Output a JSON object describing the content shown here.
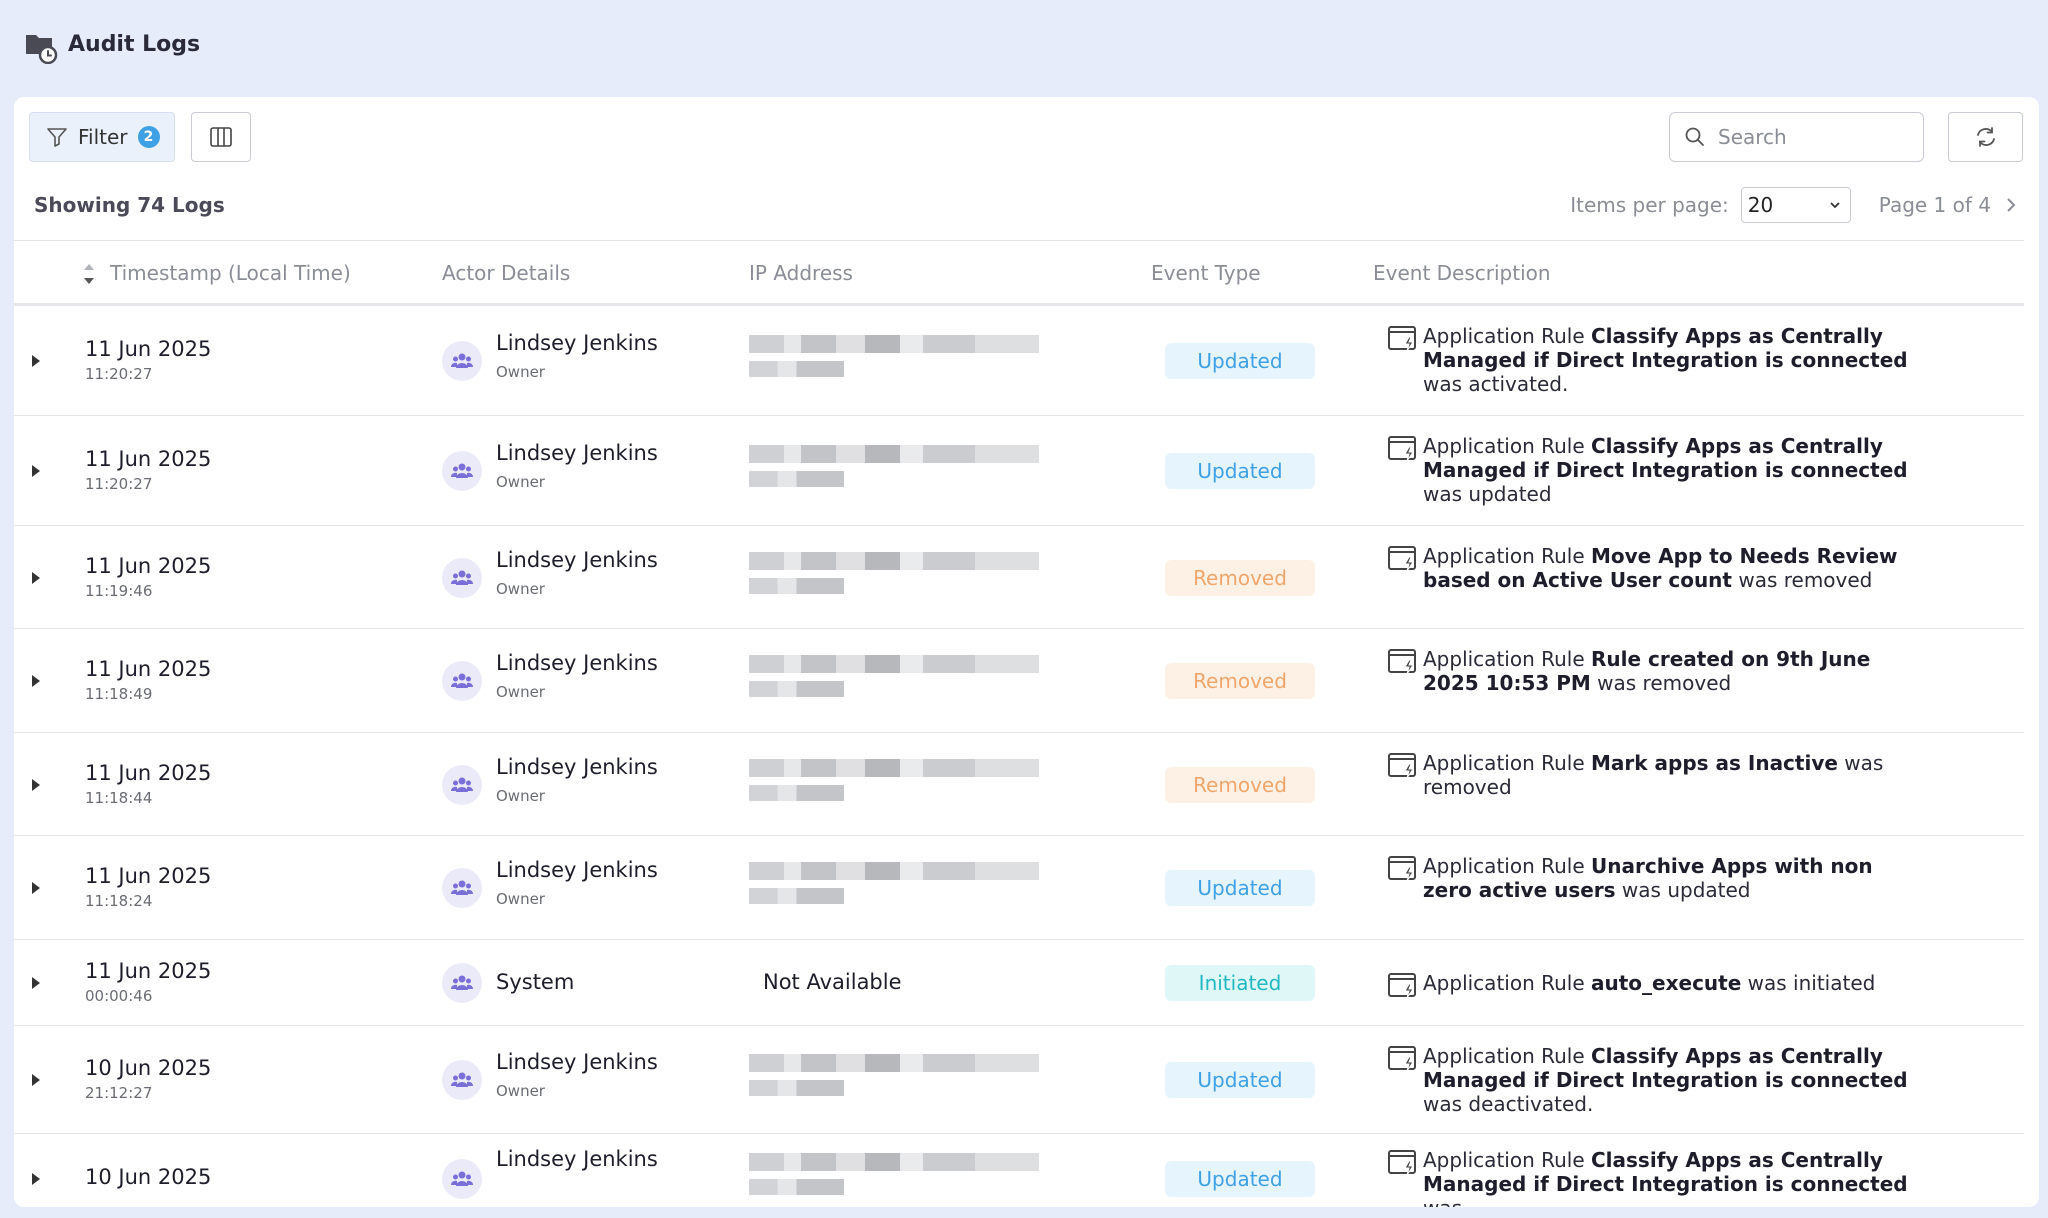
{
  "header": {
    "title": "Audit Logs"
  },
  "toolbar": {
    "filter_label": "Filter",
    "filter_count": "2",
    "search_placeholder": "Search",
    "showing_text": "Showing 74 Logs",
    "items_per_page_label": "Items per page:",
    "items_per_page_value": "20",
    "page_label": "Page 1 of 4"
  },
  "columns": {
    "timestamp": "Timestamp (Local Time)",
    "actor": "Actor Details",
    "ip": "IP Address",
    "event_type": "Event Type",
    "description": "Event Description"
  },
  "colors": {
    "updated": "#3ea1e6",
    "removed": "#f0a66a",
    "initiated": "#1fb8c3",
    "accent": "#3ea1e6"
  },
  "rows": [
    {
      "date": "11 Jun 2025",
      "time": "11:20:27",
      "actor": "Lindsey Jenkins",
      "role": "Owner",
      "ip": "",
      "event": "Updated",
      "desc_pre": "Application Rule ",
      "desc_bold": "Classify Apps as Centrally Managed if Direct Integration is connected",
      "desc_post": " was activated."
    },
    {
      "date": "11 Jun 2025",
      "time": "11:20:27",
      "actor": "Lindsey Jenkins",
      "role": "Owner",
      "ip": "",
      "event": "Updated",
      "desc_pre": "Application Rule ",
      "desc_bold": "Classify Apps as Centrally Managed if Direct Integration is connected",
      "desc_post": " was updated"
    },
    {
      "date": "11 Jun 2025",
      "time": "11:19:46",
      "actor": "Lindsey Jenkins",
      "role": "Owner",
      "ip": "",
      "event": "Removed",
      "desc_pre": "Application Rule ",
      "desc_bold": "Move App to Needs Review based on Active User count",
      "desc_post": " was removed"
    },
    {
      "date": "11 Jun 2025",
      "time": "11:18:49",
      "actor": "Lindsey Jenkins",
      "role": "Owner",
      "ip": "",
      "event": "Removed",
      "desc_pre": "Application Rule ",
      "desc_bold": "Rule created on 9th June 2025 10:53 PM",
      "desc_post": " was removed"
    },
    {
      "date": "11 Jun 2025",
      "time": "11:18:44",
      "actor": "Lindsey Jenkins",
      "role": "Owner",
      "ip": "",
      "event": "Removed",
      "desc_pre": "Application Rule ",
      "desc_bold": "Mark apps as Inactive",
      "desc_post": " was removed"
    },
    {
      "date": "11 Jun 2025",
      "time": "11:18:24",
      "actor": "Lindsey Jenkins",
      "role": "Owner",
      "ip": "",
      "event": "Updated",
      "desc_pre": "Application Rule ",
      "desc_bold": "Unarchive Apps with non zero active users",
      "desc_post": " was updated"
    },
    {
      "date": "11 Jun 2025",
      "time": "00:00:46",
      "actor": "System",
      "role": "",
      "ip": "Not Available",
      "event": "Initiated",
      "desc_pre": "Application Rule ",
      "desc_bold": "auto_execute",
      "desc_post": " was initiated"
    },
    {
      "date": "10 Jun 2025",
      "time": "21:12:27",
      "actor": "Lindsey Jenkins",
      "role": "Owner",
      "ip": "",
      "event": "Updated",
      "desc_pre": "Application Rule ",
      "desc_bold": "Classify Apps as Centrally Managed if Direct Integration is connected",
      "desc_post": " was deactivated."
    },
    {
      "date": "10 Jun 2025",
      "time": "",
      "actor": "Lindsey Jenkins",
      "role": "",
      "ip": "",
      "event": "Updated",
      "desc_pre": "Application Rule ",
      "desc_bold": "Classify Apps as Centrally Managed if Direct Integration is connected",
      "desc_post": " was"
    }
  ]
}
